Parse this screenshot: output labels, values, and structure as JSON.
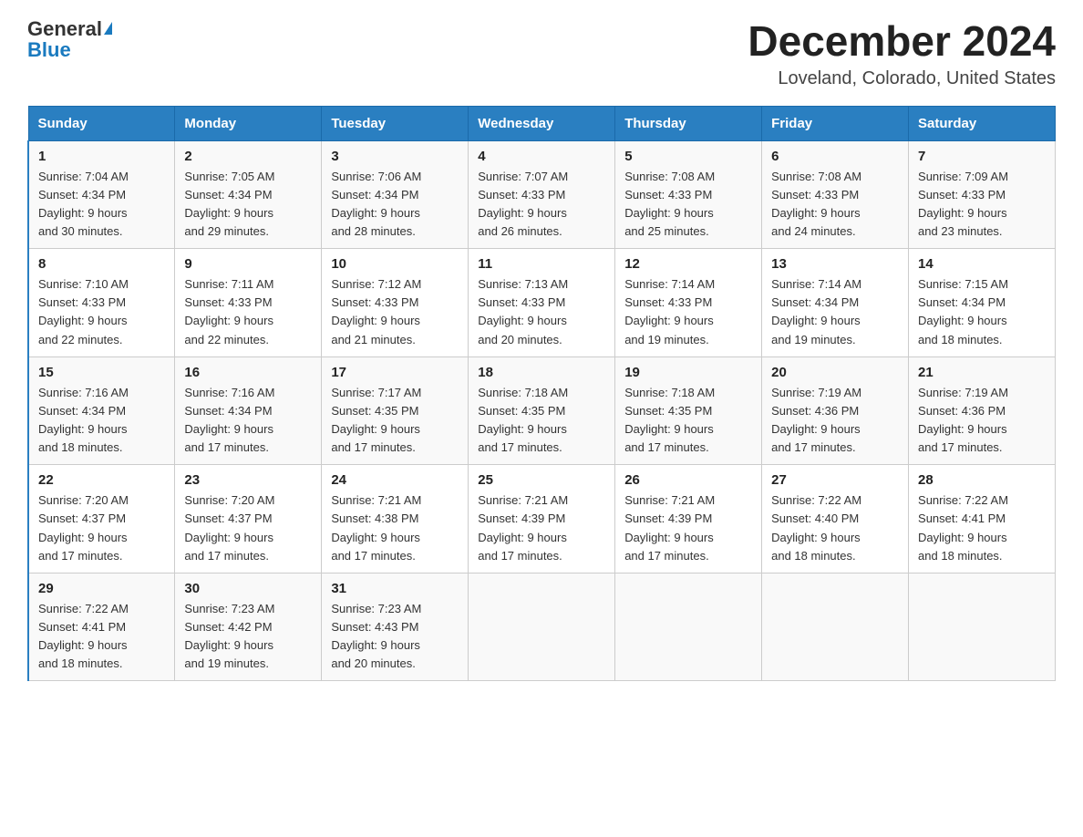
{
  "header": {
    "logo_general": "General",
    "logo_blue": "Blue",
    "title": "December 2024",
    "subtitle": "Loveland, Colorado, United States"
  },
  "days_of_week": [
    "Sunday",
    "Monday",
    "Tuesday",
    "Wednesday",
    "Thursday",
    "Friday",
    "Saturday"
  ],
  "weeks": [
    [
      {
        "day": "1",
        "sunrise": "7:04 AM",
        "sunset": "4:34 PM",
        "daylight": "9 hours and 30 minutes."
      },
      {
        "day": "2",
        "sunrise": "7:05 AM",
        "sunset": "4:34 PM",
        "daylight": "9 hours and 29 minutes."
      },
      {
        "day": "3",
        "sunrise": "7:06 AM",
        "sunset": "4:34 PM",
        "daylight": "9 hours and 28 minutes."
      },
      {
        "day": "4",
        "sunrise": "7:07 AM",
        "sunset": "4:33 PM",
        "daylight": "9 hours and 26 minutes."
      },
      {
        "day": "5",
        "sunrise": "7:08 AM",
        "sunset": "4:33 PM",
        "daylight": "9 hours and 25 minutes."
      },
      {
        "day": "6",
        "sunrise": "7:08 AM",
        "sunset": "4:33 PM",
        "daylight": "9 hours and 24 minutes."
      },
      {
        "day": "7",
        "sunrise": "7:09 AM",
        "sunset": "4:33 PM",
        "daylight": "9 hours and 23 minutes."
      }
    ],
    [
      {
        "day": "8",
        "sunrise": "7:10 AM",
        "sunset": "4:33 PM",
        "daylight": "9 hours and 22 minutes."
      },
      {
        "day": "9",
        "sunrise": "7:11 AM",
        "sunset": "4:33 PM",
        "daylight": "9 hours and 22 minutes."
      },
      {
        "day": "10",
        "sunrise": "7:12 AM",
        "sunset": "4:33 PM",
        "daylight": "9 hours and 21 minutes."
      },
      {
        "day": "11",
        "sunrise": "7:13 AM",
        "sunset": "4:33 PM",
        "daylight": "9 hours and 20 minutes."
      },
      {
        "day": "12",
        "sunrise": "7:14 AM",
        "sunset": "4:33 PM",
        "daylight": "9 hours and 19 minutes."
      },
      {
        "day": "13",
        "sunrise": "7:14 AM",
        "sunset": "4:34 PM",
        "daylight": "9 hours and 19 minutes."
      },
      {
        "day": "14",
        "sunrise": "7:15 AM",
        "sunset": "4:34 PM",
        "daylight": "9 hours and 18 minutes."
      }
    ],
    [
      {
        "day": "15",
        "sunrise": "7:16 AM",
        "sunset": "4:34 PM",
        "daylight": "9 hours and 18 minutes."
      },
      {
        "day": "16",
        "sunrise": "7:16 AM",
        "sunset": "4:34 PM",
        "daylight": "9 hours and 17 minutes."
      },
      {
        "day": "17",
        "sunrise": "7:17 AM",
        "sunset": "4:35 PM",
        "daylight": "9 hours and 17 minutes."
      },
      {
        "day": "18",
        "sunrise": "7:18 AM",
        "sunset": "4:35 PM",
        "daylight": "9 hours and 17 minutes."
      },
      {
        "day": "19",
        "sunrise": "7:18 AM",
        "sunset": "4:35 PM",
        "daylight": "9 hours and 17 minutes."
      },
      {
        "day": "20",
        "sunrise": "7:19 AM",
        "sunset": "4:36 PM",
        "daylight": "9 hours and 17 minutes."
      },
      {
        "day": "21",
        "sunrise": "7:19 AM",
        "sunset": "4:36 PM",
        "daylight": "9 hours and 17 minutes."
      }
    ],
    [
      {
        "day": "22",
        "sunrise": "7:20 AM",
        "sunset": "4:37 PM",
        "daylight": "9 hours and 17 minutes."
      },
      {
        "day": "23",
        "sunrise": "7:20 AM",
        "sunset": "4:37 PM",
        "daylight": "9 hours and 17 minutes."
      },
      {
        "day": "24",
        "sunrise": "7:21 AM",
        "sunset": "4:38 PM",
        "daylight": "9 hours and 17 minutes."
      },
      {
        "day": "25",
        "sunrise": "7:21 AM",
        "sunset": "4:39 PM",
        "daylight": "9 hours and 17 minutes."
      },
      {
        "day": "26",
        "sunrise": "7:21 AM",
        "sunset": "4:39 PM",
        "daylight": "9 hours and 17 minutes."
      },
      {
        "day": "27",
        "sunrise": "7:22 AM",
        "sunset": "4:40 PM",
        "daylight": "9 hours and 18 minutes."
      },
      {
        "day": "28",
        "sunrise": "7:22 AM",
        "sunset": "4:41 PM",
        "daylight": "9 hours and 18 minutes."
      }
    ],
    [
      {
        "day": "29",
        "sunrise": "7:22 AM",
        "sunset": "4:41 PM",
        "daylight": "9 hours and 18 minutes."
      },
      {
        "day": "30",
        "sunrise": "7:23 AM",
        "sunset": "4:42 PM",
        "daylight": "9 hours and 19 minutes."
      },
      {
        "day": "31",
        "sunrise": "7:23 AM",
        "sunset": "4:43 PM",
        "daylight": "9 hours and 20 minutes."
      },
      null,
      null,
      null,
      null
    ]
  ],
  "labels": {
    "sunrise": "Sunrise:",
    "sunset": "Sunset:",
    "daylight": "Daylight:"
  }
}
